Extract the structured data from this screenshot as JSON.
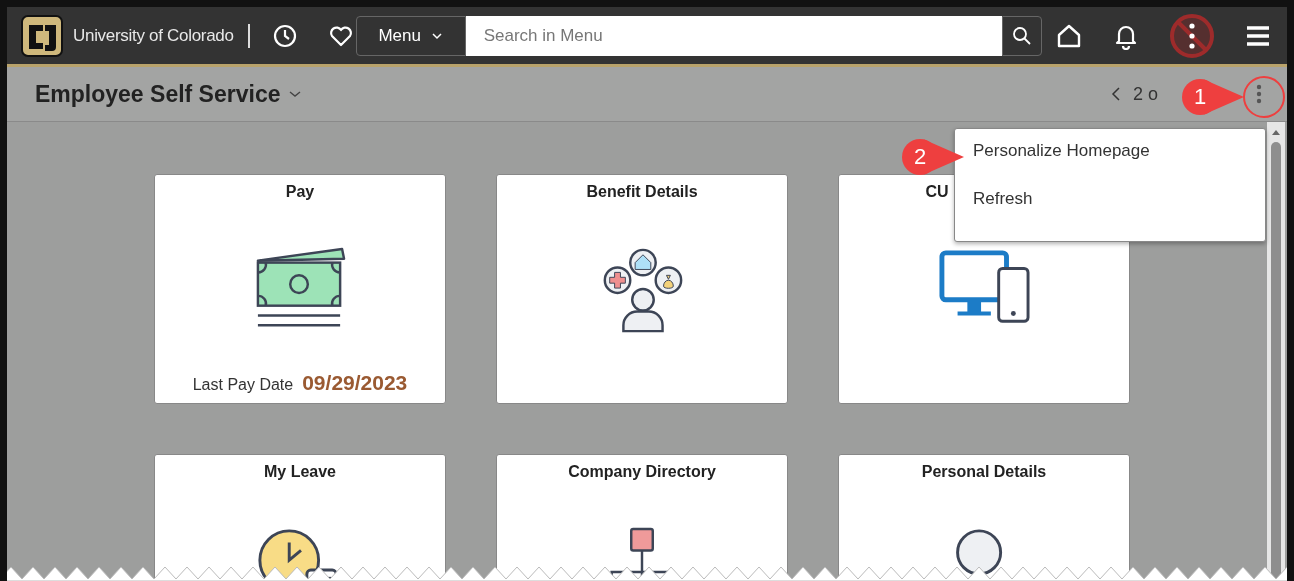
{
  "header": {
    "logo_text": "University of Colorado",
    "menu_button": "Menu",
    "search": {
      "placeholder": "Search in Menu"
    }
  },
  "subheader": {
    "title": "Employee Self Service",
    "pager": "2 o"
  },
  "dropdown": {
    "items": [
      {
        "label": "Personalize Homepage"
      },
      {
        "label": "Refresh"
      }
    ]
  },
  "callouts": [
    {
      "number": "1"
    },
    {
      "number": "2"
    }
  ],
  "tiles": [
    {
      "title": "Pay",
      "footer_label": "Last Pay Date",
      "footer_value": "09/29/2023"
    },
    {
      "title": "Benefit Details"
    },
    {
      "title": "CU"
    },
    {
      "title": "My Leave"
    },
    {
      "title": "Company Directory"
    },
    {
      "title": "Personal Details"
    }
  ]
}
